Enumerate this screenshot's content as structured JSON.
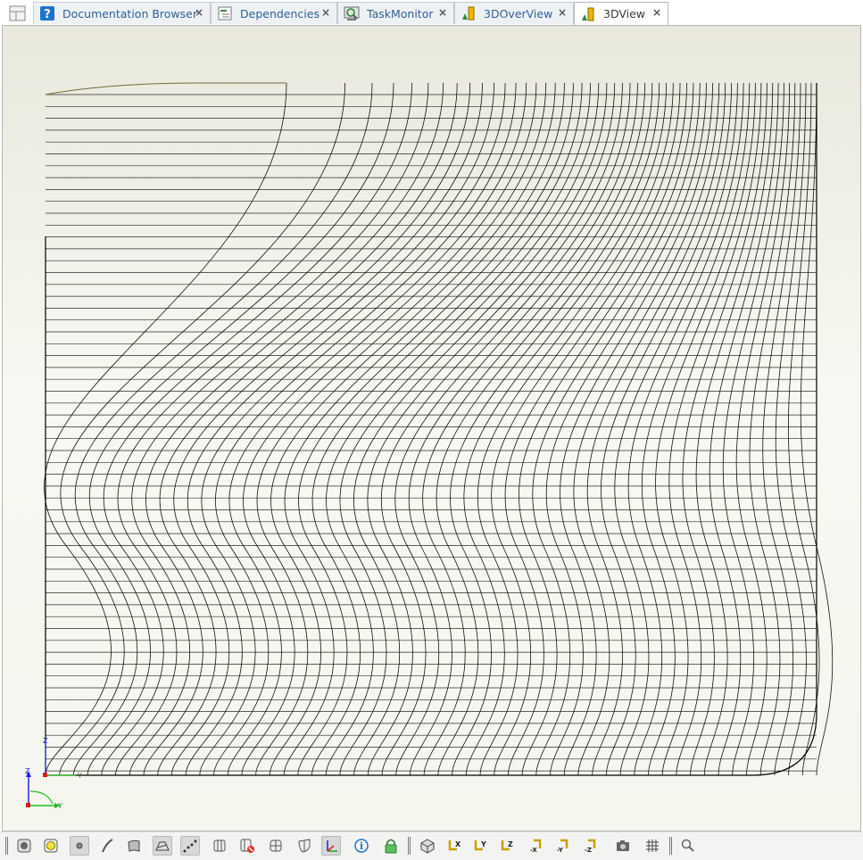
{
  "tabs": [
    {
      "label": "Documentation Browser",
      "icon": "help-icon",
      "close": "×"
    },
    {
      "label": "Dependencies",
      "icon": "dependencies-icon",
      "close": "×"
    },
    {
      "label": "TaskMonitor",
      "icon": "monitor-icon",
      "close": "×"
    },
    {
      "label": "3DOverView",
      "icon": "chart-3d-icon",
      "close": "×"
    },
    {
      "label": "3DView",
      "icon": "chart-3d-icon",
      "close": "×",
      "active": true
    }
  ],
  "axes": {
    "small": {
      "z": "Z",
      "y": "Y"
    },
    "large": {
      "z": "Z",
      "y": "Y"
    }
  },
  "toolbar": [
    "display-mode-icon",
    "shaded-icon",
    "point-icon",
    "curve-icon",
    "surface-icon",
    "wireframe-icon",
    "dotted-points-icon",
    "section-icon",
    "delete-section-icon",
    "box-icon",
    "shield-icon",
    "axes-icon",
    "info-icon",
    "lock-icon",
    "isometric-view-icon",
    "rotate-x-icon",
    "rotate-y-icon",
    "rotate-z-icon",
    "rotate-minus-x-icon",
    "rotate-minus-y-icon",
    "rotate-minus-z-icon",
    "camera-icon",
    "grid-icon",
    "zoom-icon"
  ],
  "toolbar_labels": {
    "x": "X",
    "y": "Y",
    "z": "Z",
    "mx": "-X",
    "my": "-Y",
    "mz": "-Z"
  },
  "colors": {
    "accent": "#2f5f95",
    "lines": "#000000",
    "background": "#f6f6ef"
  }
}
